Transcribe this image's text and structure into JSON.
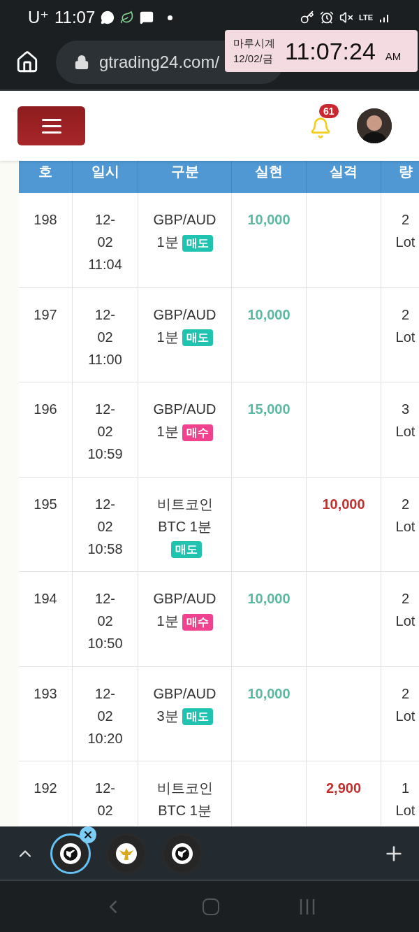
{
  "status_bar": {
    "carrier": "U⁺",
    "time": "11:07",
    "network": "LTE"
  },
  "address_bar": {
    "url": "gtrading24.com/"
  },
  "clock_widget": {
    "title": "마루시계",
    "date": "12/02/금",
    "time": "11:07:24",
    "meridiem": "AM"
  },
  "header": {
    "notification_count": "61"
  },
  "table": {
    "columns": [
      "호",
      "일시",
      "구분",
      "실현",
      "실격",
      "량"
    ],
    "rows": [
      {
        "no": "198",
        "date": "12-02",
        "time": "11:04",
        "instrument": "GBP/AUD",
        "period": "1분",
        "tag": {
          "label": "매도",
          "color": "#1fc3b0"
        },
        "profit": "10,000",
        "lots": "2 Lot"
      },
      {
        "no": "197",
        "date": "12-02",
        "time": "11:00",
        "instrument": "GBP/AUD",
        "period": "1분",
        "tag": {
          "label": "매도",
          "color": "#1fc3b0"
        },
        "profit": "10,000",
        "lots": "2 Lot"
      },
      {
        "no": "196",
        "date": "12-02",
        "time": "10:59",
        "instrument": "GBP/AUD",
        "period": "1분",
        "tag": {
          "label": "매수",
          "color": "#f0428e"
        },
        "profit": "15,000",
        "lots": "3 Lot"
      },
      {
        "no": "195",
        "date": "12-02",
        "time": "10:58",
        "instrument": "비트코인 BTC",
        "period": "1분",
        "tag": {
          "label": "매도",
          "color": "#1fc3b0"
        },
        "loss": "10,000",
        "lots": "2 Lot"
      },
      {
        "no": "194",
        "date": "12-02",
        "time": "10:50",
        "instrument": "GBP/AUD",
        "period": "1분",
        "tag": {
          "label": "매수",
          "color": "#f0428e"
        },
        "profit": "10,000",
        "lots": "2 Lot"
      },
      {
        "no": "193",
        "date": "12-02",
        "time": "10:20",
        "instrument": "GBP/AUD",
        "period": "3분",
        "tag": {
          "label": "매도",
          "color": "#1fc3b0"
        },
        "profit": "10,000",
        "lots": "2 Lot"
      },
      {
        "no": "192",
        "date": "12-02",
        "instrument": "비트코인 BTC",
        "period": "1분",
        "loss": "2,900",
        "lots": "1 Lot"
      }
    ]
  },
  "tab_bar": {
    "tabs": [
      {
        "kind": "globe",
        "selected": true
      },
      {
        "kind": "emblem",
        "selected": false
      },
      {
        "kind": "globe",
        "selected": false
      }
    ]
  }
}
